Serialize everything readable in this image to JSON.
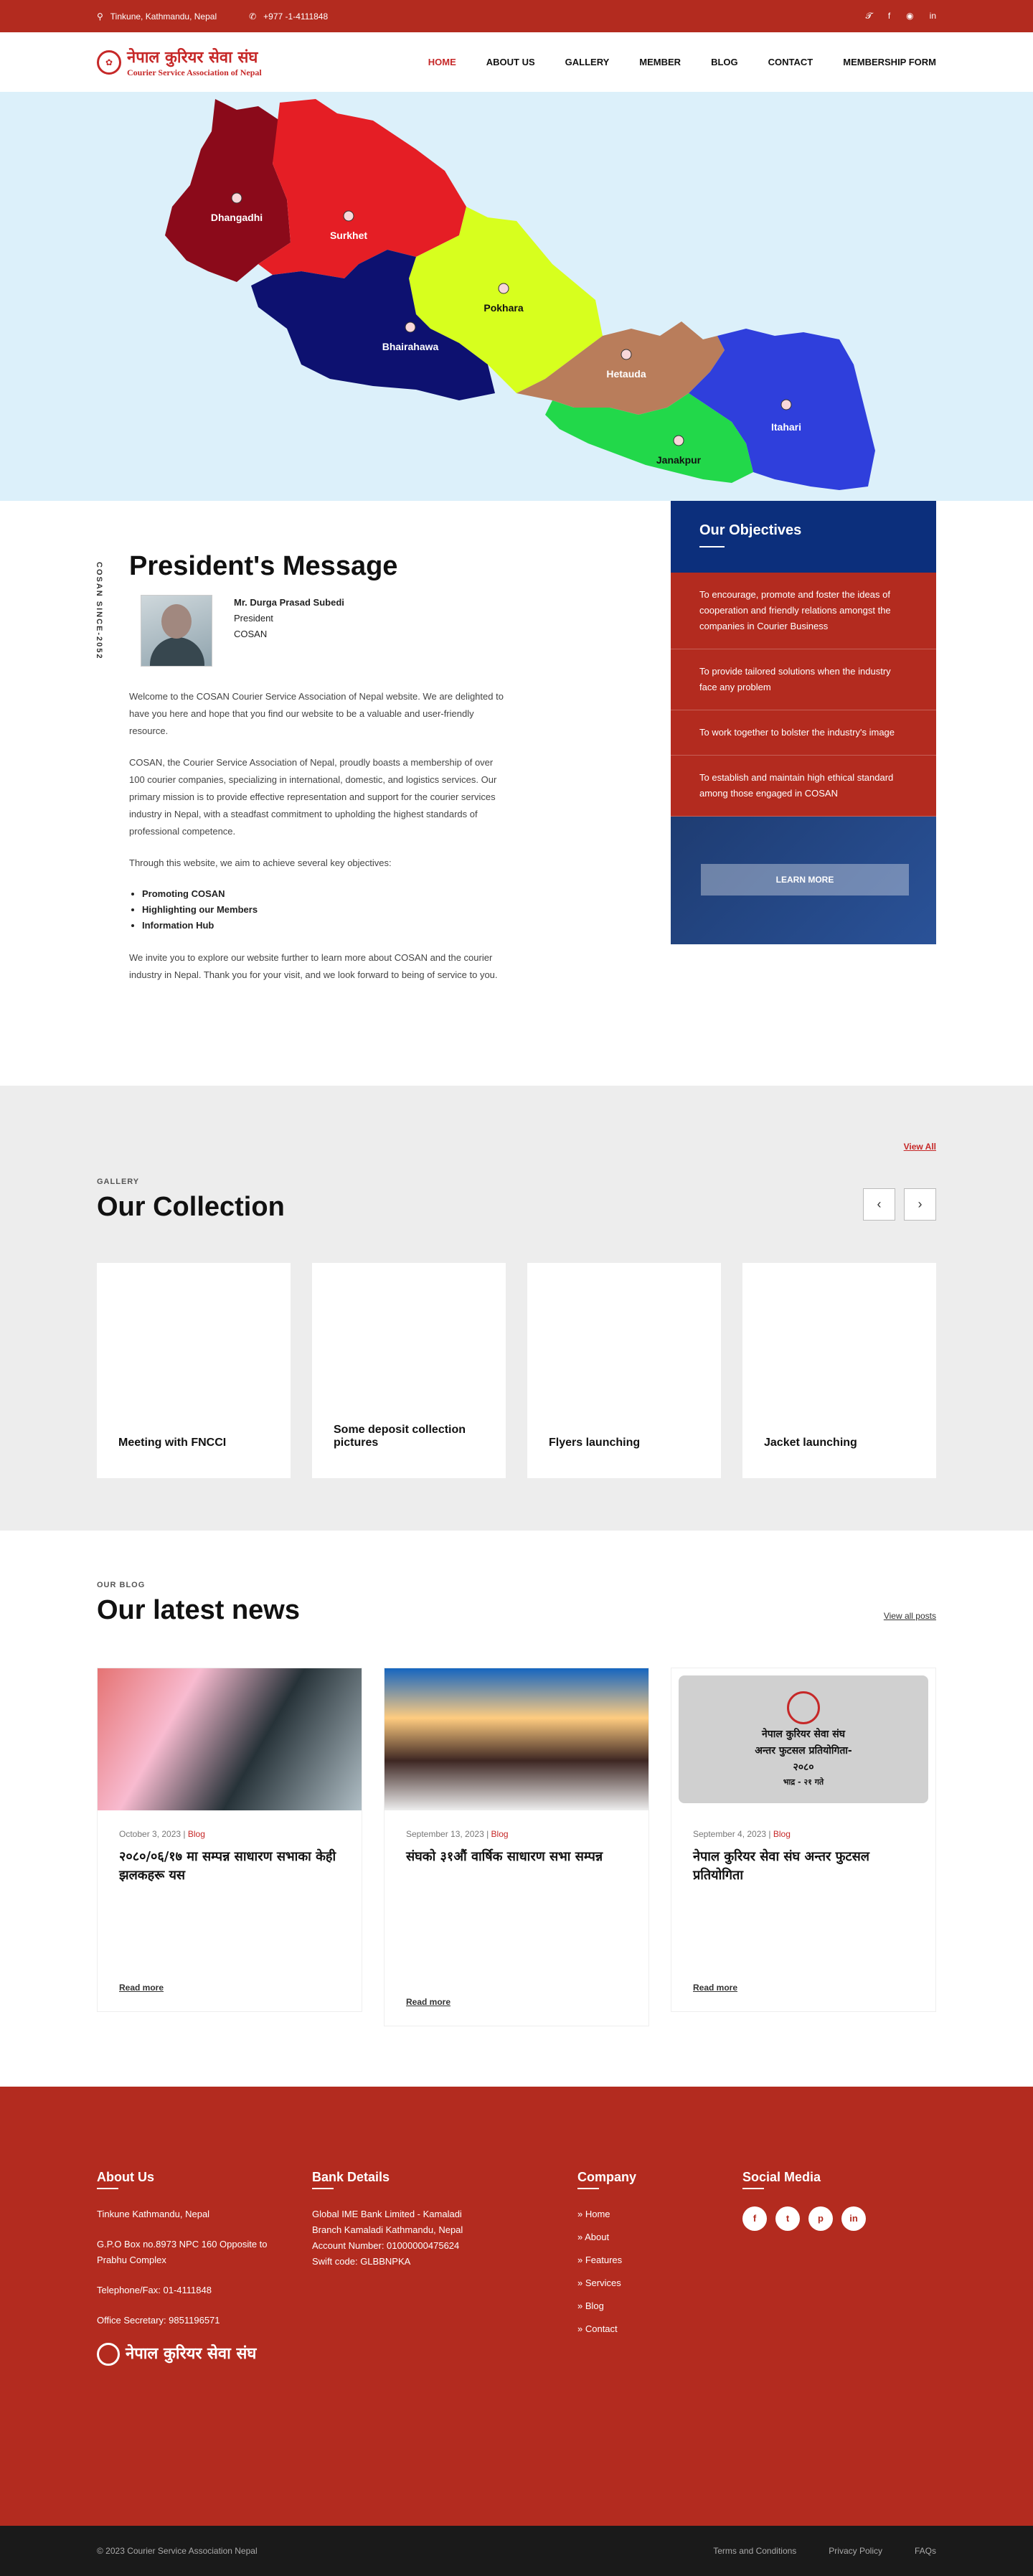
{
  "topbar": {
    "address": "Tinkune, Kathmandu, Nepal",
    "phone": "+977 -1-4111848",
    "social_icons": [
      "twitter-icon",
      "facebook-icon",
      "instagram-icon",
      "linkedin-icon"
    ]
  },
  "header": {
    "logo_nepali": "नेपाल कुरियर सेवा संघ",
    "logo_english": "Courier Service Association of Nepal",
    "nav": [
      "HOME",
      "ABOUT US",
      "GALLERY",
      "MEMBER",
      "BLOG",
      "CONTACT",
      "MEMBERSHIP FORM"
    ],
    "active_nav": "HOME"
  },
  "map": {
    "cities": [
      "Dhangadhi",
      "Surkhet",
      "Pokhara",
      "Bhairahawa",
      "Hetauda",
      "Itahari",
      "Janakpur"
    ],
    "region_colors": [
      "#8b0a1a",
      "#e51e25",
      "#d7ff1e",
      "#0d1170",
      "#b97d5b",
      "#2f3fdc",
      "#22d84a"
    ]
  },
  "president": {
    "side_label": "COSAN SINCE-2052",
    "title": "President's Message",
    "name": "Mr. Durga Prasad Subedi",
    "role": "President",
    "org": "COSAN",
    "paragraphs": [
      "Welcome to the COSAN Courier Service Association of Nepal website. We are delighted to have you here and hope that you find our website to be a valuable and user-friendly resource.",
      "COSAN, the Courier Service Association of Nepal, proudly boasts a membership of over 100 courier companies, specializing in international, domestic, and logistics services. Our primary mission is to provide effective representation and support for the courier services industry in Nepal, with a steadfast commitment to upholding the highest standards of professional competence.",
      "Through this website, we aim to achieve several key objectives:"
    ],
    "bullets": [
      "Promoting COSAN",
      "Highlighting our Members",
      "Information Hub"
    ],
    "closing": "We invite you to explore our website further to learn more about COSAN and the courier industry in Nepal. Thank you for your visit, and we look forward to being of service to you."
  },
  "objectives": {
    "title": "Our Objectives",
    "items": [
      "To encourage, promote and foster the ideas of cooperation and friendly relations amongst the companies in Courier Business",
      "To provide tailored solutions when the industry face any problem",
      "To work together to bolster the industry's image",
      "To establish and maintain high ethical standard among those engaged in COSAN"
    ],
    "button": "LEARN MORE"
  },
  "collection": {
    "view_all": "View All",
    "eyebrow": "GALLERY",
    "title": "Our Collection",
    "prev": "‹",
    "next": "›",
    "cards": [
      "Meeting with FNCCI",
      "Some deposit collection pictures",
      "Flyers launching",
      "Jacket launching"
    ]
  },
  "blog": {
    "eyebrow": "OUR BLOG",
    "title": "Our latest news",
    "view_all": "View all posts",
    "posts": [
      {
        "date": "October 3, 2023",
        "cat": "Blog",
        "title": "२०८०/०६/१७ मा सम्पन्न साधारण सभाका केही झलकहरू यस",
        "read": "Read more"
      },
      {
        "date": "September 13, 2023",
        "cat": "Blog",
        "title": "संघको ३१औं वार्षिक साधारण सभा सम्पन्न",
        "read": "Read more"
      },
      {
        "date": "September 4, 2023",
        "cat": "Blog",
        "title": "नेपाल कुरियर सेवा संघ अन्तर फुटसल प्रतियोगिता",
        "read": "Read more"
      }
    ],
    "post3_image_text": [
      "नेपाल कुरियर सेवा संघ",
      "अन्तर फुटसल प्रतियोगिता-",
      "२०८०",
      "भाद्र - २१ गते"
    ]
  },
  "footer": {
    "about_title": "About Us",
    "about_lines": [
      "Tinkune Kathmandu, Nepal",
      "G.P.O Box no.8973 NPC 160 Opposite to Prabhu Complex",
      "Telephone/Fax: 01-4111848",
      "Office Secretary: 9851196571"
    ],
    "logo": "नेपाल कुरियर सेवा संघ",
    "bank_title": "Bank Details",
    "bank_lines": [
      "Global IME Bank Limited - Kamaladi Branch Kamaladi Kathmandu, Nepal",
      "Account Number: 01000000475624",
      "Swift code: GLBBNPKA"
    ],
    "company_title": "Company",
    "company_links": [
      "Home",
      "About",
      "Features",
      "Services",
      "Blog",
      "Contact"
    ],
    "social_title": "Social Media",
    "social": [
      "f",
      "t",
      "p",
      "in"
    ]
  },
  "copyright": {
    "text": "© 2023 Courier Service Association Nepal",
    "links": [
      "Terms and Conditions",
      "Privacy Policy",
      "FAQs"
    ]
  }
}
